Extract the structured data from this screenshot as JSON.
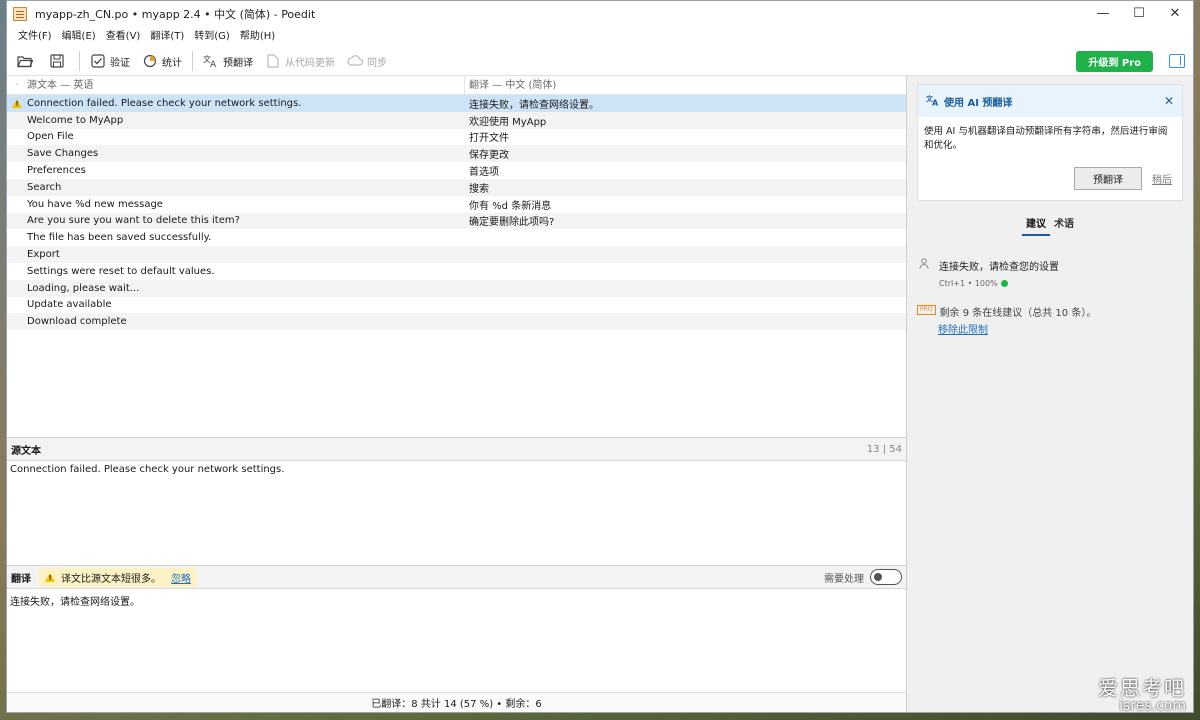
{
  "window": {
    "title": "myapp-zh_CN.po • myapp 2.4 • 中文 (简体)  - Poedit",
    "controls": [
      "—",
      "☐",
      "✕"
    ]
  },
  "menu": [
    "文件(F)",
    "编辑(E)",
    "查看(V)",
    "翻译(T)",
    "转到(G)",
    "帮助(H)"
  ],
  "toolbar": {
    "validate": "验证",
    "stats": "统计",
    "pretranslate": "预翻译",
    "update_from_code": "从代码更新",
    "sync": "同步",
    "upgrade": "升级到 Pro"
  },
  "list": {
    "header_source": "源文本 — 英语",
    "header_translation": "翻译 — 中文 (简体)",
    "rows": [
      {
        "source": "Connection failed. Please check your network settings.",
        "translation": "连接失败，请检查网络设置。",
        "warning": true
      },
      {
        "source": "Welcome to MyApp",
        "translation": "欢迎使用 MyApp"
      },
      {
        "source": "Open File",
        "translation": "打开文件"
      },
      {
        "source": "Save Changes",
        "translation": "保存更改"
      },
      {
        "source": "Preferences",
        "translation": "首选项"
      },
      {
        "source": "Search",
        "translation": "搜索"
      },
      {
        "source": "You have %d new message",
        "translation": "你有 %d 条新消息"
      },
      {
        "source": "Are you sure you want to delete this item?",
        "translation": "确定要删除此项吗?"
      },
      {
        "source": "The file has been saved successfully.",
        "translation": ""
      },
      {
        "source": "Export",
        "translation": ""
      },
      {
        "source": "Settings were reset to default values.",
        "translation": ""
      },
      {
        "source": "Loading, please wait...",
        "translation": ""
      },
      {
        "source": "Update available",
        "translation": ""
      },
      {
        "source": "Download complete",
        "translation": ""
      }
    ]
  },
  "source_panel": {
    "title": "源文本",
    "count": "13 | 54",
    "text": "Connection failed. Please check your network settings."
  },
  "translation_panel": {
    "title": "翻译",
    "warning": "译文比源文本短很多。",
    "ignore": "忽略",
    "needs_work": "需要处理",
    "text": "连接失败，请检查网络设置。"
  },
  "status": "已翻译：8 共计 14 (57 %)  •  剩余：6",
  "sidebar": {
    "ai_title": "使用 AI 预翻译",
    "ai_body": "使用 AI 与机器翻译自动预翻译所有字符串，然后进行审阅和优化。",
    "ai_button": "预翻译",
    "ai_later": "稍后",
    "tabs": [
      "建议",
      "术语"
    ],
    "suggestion_text": "连接失败，请检查您的设置",
    "suggestion_meta": "Ctrl+1 • 100%",
    "pro_badge": "PRO",
    "pro_text": "剩余 9 条在线建议（总共 10 条）。",
    "pro_link": "移除此限制"
  },
  "watermark": {
    "line1": "爱思考吧",
    "line2": "isres.com"
  },
  "colors": {
    "accent": "#1a5c9e",
    "upgrade": "#1fb24a",
    "selected_row": "#cde4f7",
    "warning": "#f2c200"
  }
}
